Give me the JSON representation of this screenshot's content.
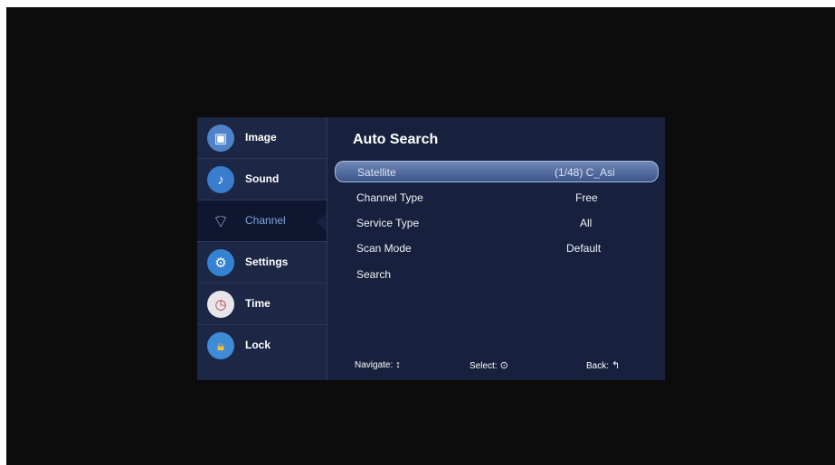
{
  "sidebar": {
    "items": [
      {
        "label": "Image",
        "icon": "image-icon",
        "color": "#5d8fd6"
      },
      {
        "label": "Sound",
        "icon": "music-note-icon",
        "color": "#3c7fd0"
      },
      {
        "label": "Channel",
        "icon": "satellite-dish-icon",
        "color": "#9bb3d8"
      },
      {
        "label": "Settings",
        "icon": "gear-icon",
        "color": "#3a86d6"
      },
      {
        "label": "Time",
        "icon": "clock-icon",
        "color": "#d04a4a"
      },
      {
        "label": "Lock",
        "icon": "lock-icon",
        "color": "#4a90d9"
      }
    ],
    "active": "Channel"
  },
  "panel": {
    "title": "Auto Search",
    "rows": [
      {
        "name": "Satellite",
        "value": "(1/48) C_Asi"
      },
      {
        "name": "Channel Type",
        "value": "Free"
      },
      {
        "name": "Service Type",
        "value": "All"
      },
      {
        "name": "Scan Mode",
        "value": "Default"
      },
      {
        "name": "Search",
        "value": ""
      }
    ]
  },
  "footer": {
    "navigate": "Navigate:",
    "navigate_glyph": "↕",
    "select": "Select:",
    "select_glyph": "⊙",
    "back": "Back:",
    "back_glyph": "↰"
  }
}
